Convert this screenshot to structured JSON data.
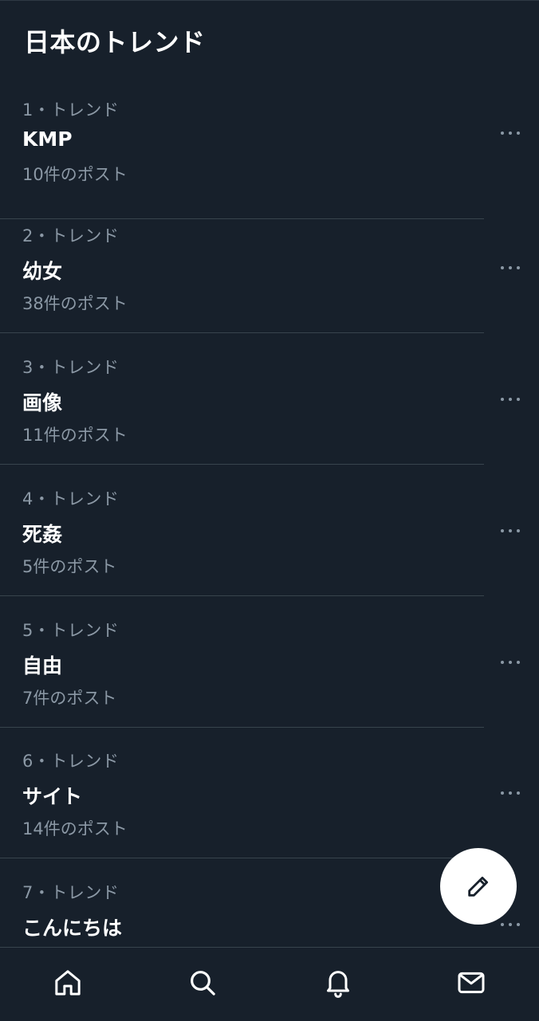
{
  "header": {
    "title": "日本のトレンド"
  },
  "trends": [
    {
      "meta": "1・トレンド",
      "name": "KMP",
      "count": "10件のポスト"
    },
    {
      "meta": "2・トレンド",
      "name": "幼女",
      "count": "38件のポスト"
    },
    {
      "meta": "3・トレンド",
      "name": "画像",
      "count": "11件のポスト"
    },
    {
      "meta": "4・トレンド",
      "name": "死姦",
      "count": "5件のポスト"
    },
    {
      "meta": "5・トレンド",
      "name": "自由",
      "count": "7件のポスト"
    },
    {
      "meta": "6・トレンド",
      "name": "サイト",
      "count": "14件のポスト"
    },
    {
      "meta": "7・トレンド",
      "name": "こんにちは",
      "count": ""
    }
  ],
  "fab": {
    "icon": "pencil-icon"
  },
  "bottom_nav": {
    "items": [
      {
        "icon": "home-icon"
      },
      {
        "icon": "search-icon"
      },
      {
        "icon": "bell-icon"
      },
      {
        "icon": "mail-icon"
      }
    ]
  },
  "colors": {
    "background": "#17202b",
    "text_primary": "#ffffff",
    "text_secondary": "#8b98a5",
    "divider": "#38444d"
  }
}
